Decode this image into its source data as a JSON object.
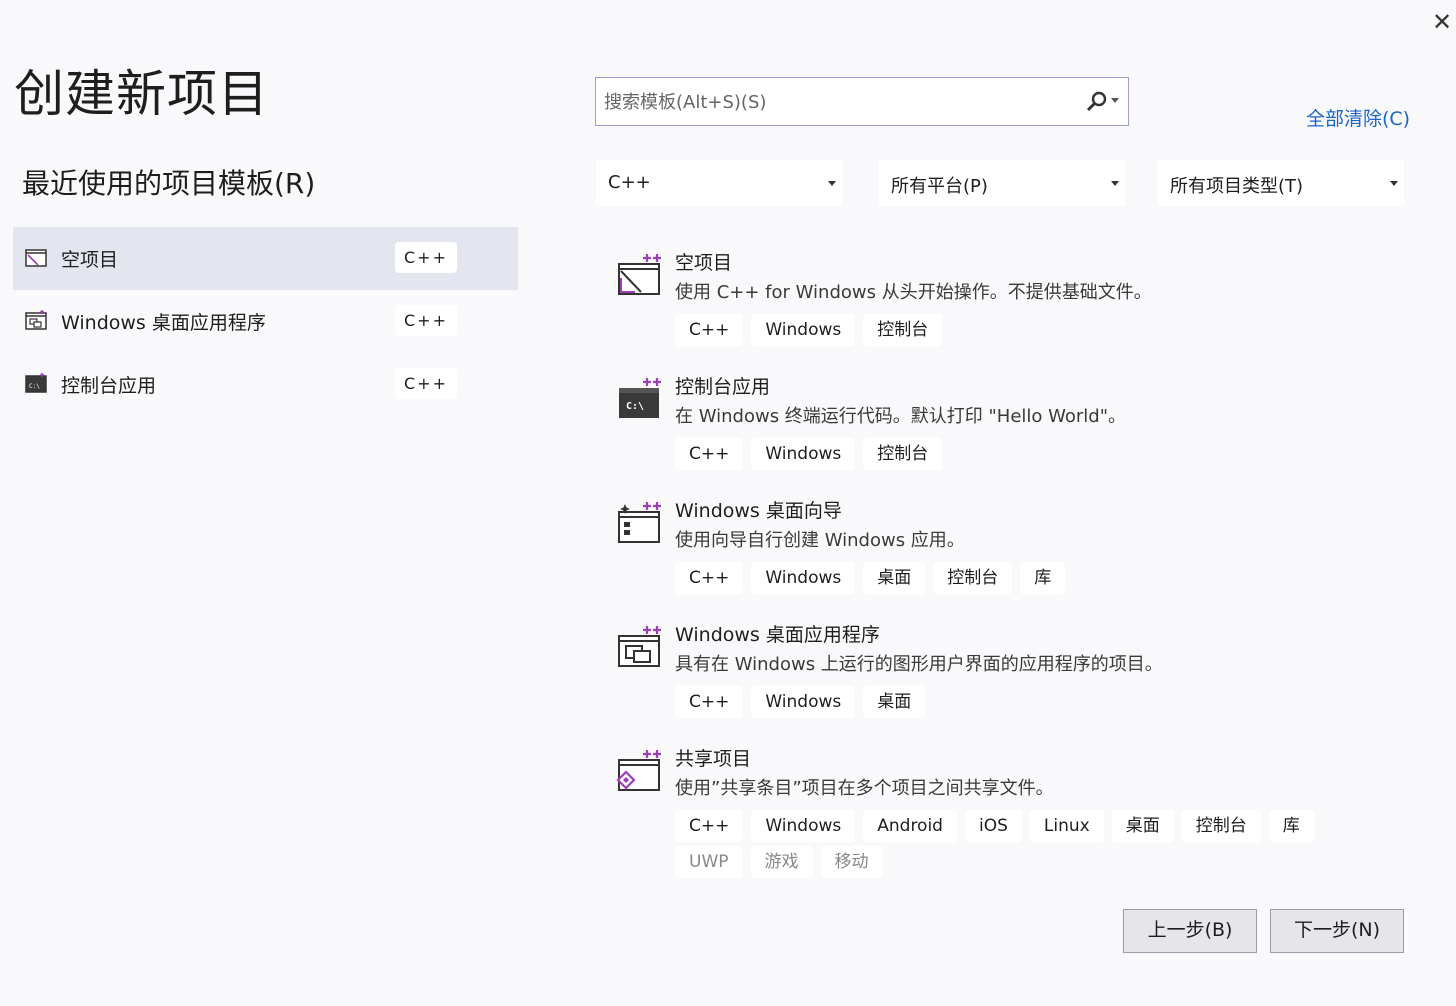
{
  "window": {
    "close_glyph": "✕"
  },
  "title": "创建新项目",
  "recent": {
    "heading": "最近使用的项目模板(R)",
    "items": [
      {
        "label": "空项目",
        "tag": "C++",
        "icon": "empty-project-icon",
        "selected": true
      },
      {
        "label": "Windows 桌面应用程序",
        "tag": "C++",
        "icon": "desktop-app-icon",
        "selected": false
      },
      {
        "label": "控制台应用",
        "tag": "C++",
        "icon": "console-app-icon",
        "selected": false
      }
    ]
  },
  "search": {
    "placeholder": "搜索模板(Alt+S)(S)",
    "value": ""
  },
  "clear_all": "全部清除(C)",
  "filters": {
    "language": "C++",
    "platform": "所有平台(P)",
    "project_type": "所有项目类型(T)"
  },
  "templates": [
    {
      "name": "空项目",
      "desc": "使用 C++ for Windows 从头开始操作。不提供基础文件。",
      "tags": [
        "C++",
        "Windows",
        "控制台"
      ],
      "dim_tags": [],
      "icon": "empty-project-icon"
    },
    {
      "name": "控制台应用",
      "desc": "在 Windows 终端运行代码。默认打印 \"Hello World\"。",
      "tags": [
        "C++",
        "Windows",
        "控制台"
      ],
      "dim_tags": [],
      "icon": "console-app-icon"
    },
    {
      "name": "Windows 桌面向导",
      "desc": "使用向导自行创建 Windows 应用。",
      "tags": [
        "C++",
        "Windows",
        "桌面",
        "控制台",
        "库"
      ],
      "dim_tags": [],
      "icon": "desktop-wizard-icon"
    },
    {
      "name": "Windows 桌面应用程序",
      "desc": "具有在 Windows 上运行的图形用户界面的应用程序的项目。",
      "tags": [
        "C++",
        "Windows",
        "桌面"
      ],
      "dim_tags": [],
      "icon": "desktop-app-icon"
    },
    {
      "name": "共享项目",
      "desc": "使用”共享条目”项目在多个项目之间共享文件。",
      "tags": [
        "C++",
        "Windows",
        "Android",
        "iOS",
        "Linux",
        "桌面",
        "控制台",
        "库"
      ],
      "dim_tags": [
        "UWP",
        "游戏",
        "移动"
      ],
      "icon": "shared-project-icon"
    }
  ],
  "buttons": {
    "back": "上一步(B)",
    "next": "下一步(N)"
  },
  "colors": {
    "accent_purple": "#9b3fb4",
    "link_blue": "#1a64c8",
    "selected_row": "#e4e6ef"
  }
}
